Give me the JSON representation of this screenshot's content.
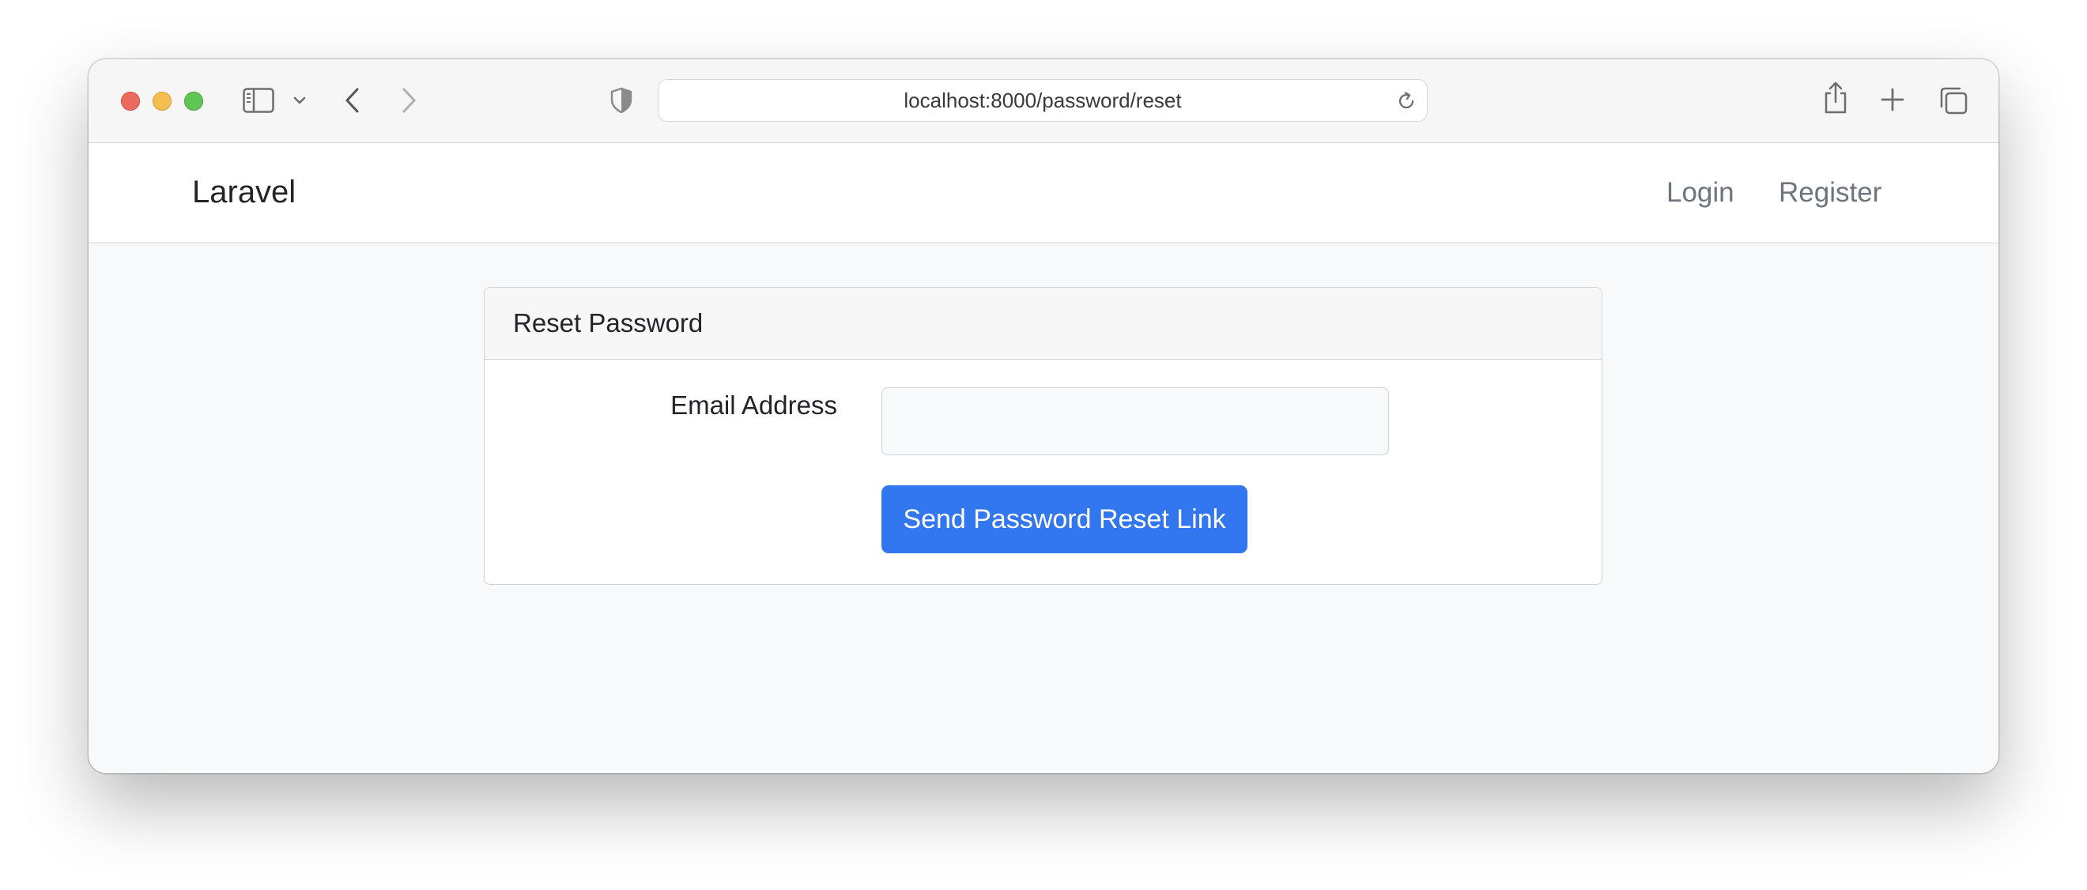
{
  "browser": {
    "url": "localhost:8000/password/reset",
    "icons": {
      "close": "close-traffic-light",
      "minimize": "minimize-traffic-light",
      "zoom": "zoom-traffic-light",
      "sidebar": "sidebar-icon",
      "sidebar_menu": "chevron-down-icon",
      "back": "back-chevron-icon",
      "forward": "forward-chevron-icon",
      "privacy": "shield-icon",
      "reload": "reload-icon",
      "share": "share-icon",
      "new_tab": "plus-icon",
      "tab_overview": "tabs-icon"
    }
  },
  "navbar": {
    "brand": "Laravel",
    "links": [
      {
        "label": "Login"
      },
      {
        "label": "Register"
      }
    ]
  },
  "card": {
    "title": "Reset Password",
    "email_label": "Email Address",
    "email_value": "",
    "submit_label": "Send Password Reset Link"
  },
  "colors": {
    "primary_button": "#3377f0",
    "page_background": "#f8f9fa",
    "nav_link": "#6c757d"
  }
}
